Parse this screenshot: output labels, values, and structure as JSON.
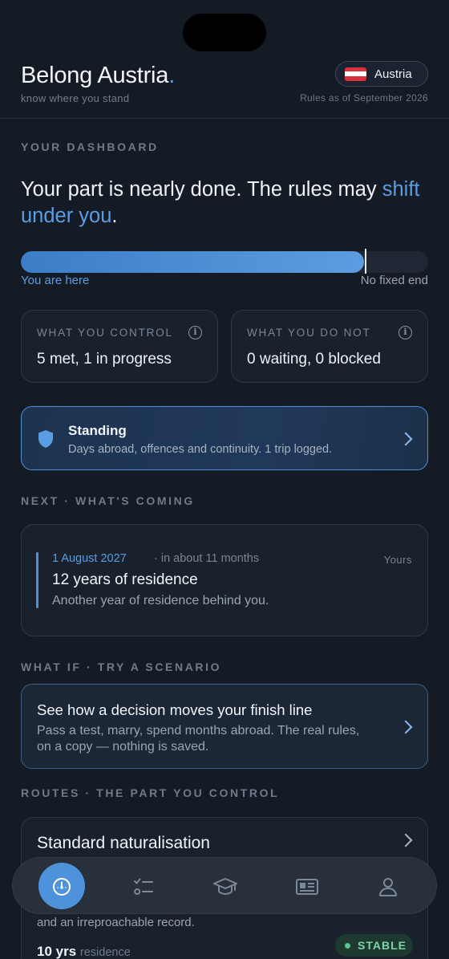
{
  "header": {
    "brand": "Belong Austria",
    "brand_dot": ".",
    "tagline": "know where you stand",
    "country": "Austria",
    "rules_date": "Rules as of September 2026"
  },
  "dashboard": {
    "section_label": "YOUR DASHBOARD",
    "headline_start": "Your part is nearly done. The rules may ",
    "headline_accent": "shift under you",
    "headline_end": ".",
    "progress_fraction": 0.83,
    "you_are_here": "You are here",
    "no_fixed_end": "No fixed end",
    "control_title": "WHAT YOU CONTROL",
    "control_value": "5 met, 1 in progress",
    "not_control_title": "WHAT YOU DO NOT",
    "not_control_value": "0 waiting, 0 blocked"
  },
  "standing": {
    "title": "Standing",
    "subtitle": "Days abroad, offences and continuity. 1 trip logged."
  },
  "next": {
    "section_label": "NEXT · WHAT'S COMING",
    "date": "1 August 2027",
    "relative": "· in about 11 months",
    "owner": "Yours",
    "title": "12 years of residence",
    "subtitle": "Another year of residence behind you."
  },
  "scenario": {
    "section_label": "WHAT IF · TRY A SCENARIO",
    "title": "See how a decision moves your finish line",
    "subtitle": "Pass a test, marry, spend months abroad. The real rules, on a copy — nothing is saved."
  },
  "routes": {
    "section_label": "ROUTES · THE PART YOU CONTROL",
    "title": "Standard naturalisation",
    "desc": "and an irreproachable record.",
    "years": "10 yrs",
    "years_unit": "residence",
    "badge": "STABLE"
  },
  "tabs": [
    {
      "icon": "gauge-icon",
      "active": true
    },
    {
      "icon": "checklist-icon",
      "active": false
    },
    {
      "icon": "graduation-cap-icon",
      "active": false
    },
    {
      "icon": "id-card-icon",
      "active": false
    },
    {
      "icon": "profile-icon",
      "active": false
    }
  ],
  "colors": {
    "background": "#141b25",
    "accent": "#5b9de3",
    "stable_green": "#7ed3a4"
  }
}
